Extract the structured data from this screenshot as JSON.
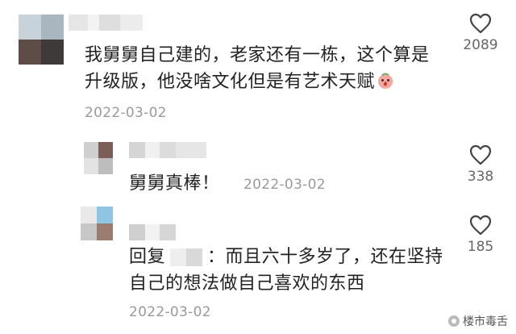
{
  "comments": [
    {
      "text_line1": "我舅舅自己建的，老家还有一栋，这个算是",
      "text_line2": "升级版，他没啥文化但是有艺术天赋",
      "emoji": "blush-face-emoji",
      "date": "2022-03-02",
      "likes": "2089"
    },
    {
      "text": "舅舅真棒！",
      "date": "2022-03-02",
      "likes": "338"
    },
    {
      "reply_prefix": "回复",
      "text_line1": "：而且六十多岁了，还在坚持",
      "text_line2": "自己的想法做自己喜欢的东西",
      "date": "2022-03-02",
      "likes": "185"
    }
  ],
  "watermark": "楼市毒舌",
  "icons": {
    "like": "heart-outline-icon",
    "watermark": "watermark-logo-icon"
  }
}
